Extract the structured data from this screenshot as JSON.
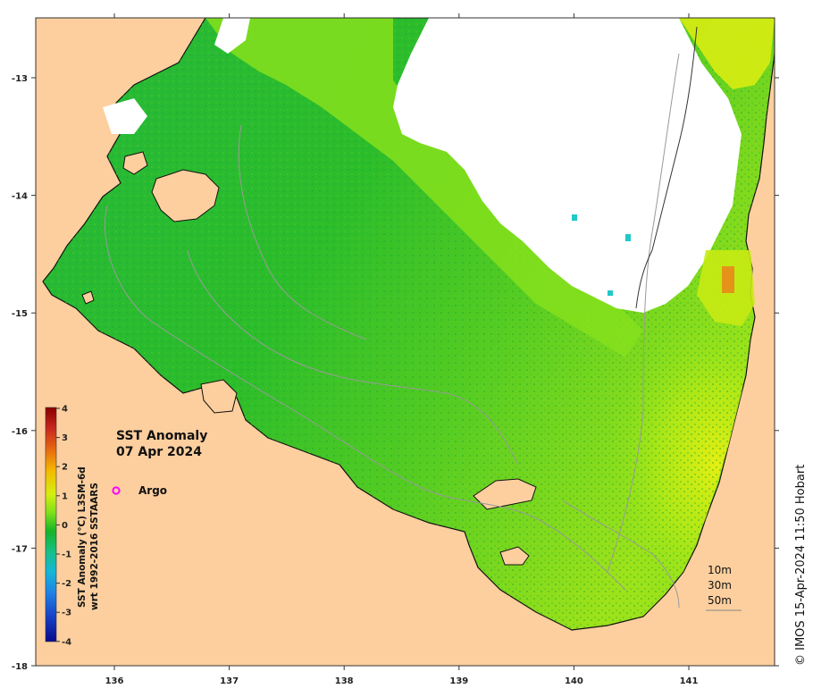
{
  "map": {
    "title_line1": "SST Anomaly",
    "title_line2": "07 Apr 2024",
    "lon_ticks": [
      "136",
      "137",
      "138",
      "139",
      "140",
      "141"
    ],
    "lat_ticks": [
      "-13",
      "-14",
      "-15",
      "-16",
      "-17",
      "-18"
    ],
    "legend": {
      "argo_label": "Argo",
      "argo_color": "#ff00ff"
    },
    "depth_labels": [
      "10m",
      "30m",
      "50m"
    ],
    "colorbar": {
      "title_line1": "SST Anomaly (°C) L3SM-6d",
      "title_line2": "wrt 1992-2016 SSTAARS",
      "ticks": [
        "4",
        "3",
        "2",
        "1",
        "0",
        "-1",
        "-2",
        "-3",
        "-4"
      ],
      "colors": [
        "#8b0000",
        "#c8281e",
        "#e86a10",
        "#f5b800",
        "#d6ef10",
        "#7de01a",
        "#14b428",
        "#16c08a",
        "#12b8d6",
        "#1f82e6",
        "#1743c8",
        "#0a0a8c"
      ]
    },
    "credit": "© IMOS 15-Apr-2024 11:50 Hobart",
    "colors": {
      "land": "#fdcf9e",
      "no_data": "#ffffff",
      "sea_main": "#2bbc2a",
      "sea_light": "#7fe01f",
      "sea_yellow": "#ccee12",
      "sea_warm": "#eef010"
    }
  }
}
